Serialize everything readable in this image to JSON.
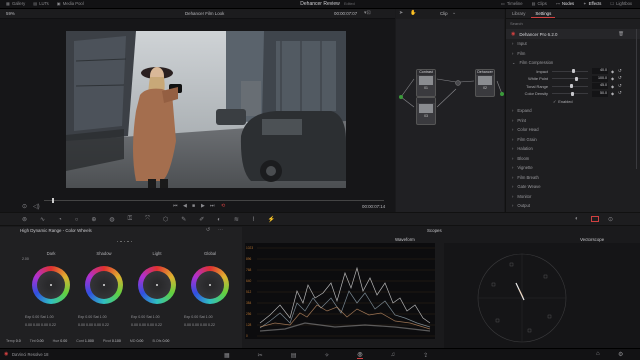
{
  "topbar": {
    "left_items": [
      {
        "icon": "media-pool-icon",
        "label": "Gallery"
      },
      {
        "icon": "luts-icon",
        "label": "LUTs"
      },
      {
        "icon": "media-pool-icon",
        "label": "Media Pool"
      }
    ],
    "title": "Dehancer Review",
    "edited": "Edited",
    "right_items": [
      {
        "icon": "timeline-icon",
        "label": "Timeline"
      },
      {
        "icon": "clips-icon",
        "label": "Clips"
      },
      {
        "icon": "nodes-icon",
        "label": "Nodes"
      },
      {
        "icon": "effects-icon",
        "label": "Effects"
      },
      {
        "icon": "lightbox-icon",
        "label": "Lightbox"
      }
    ]
  },
  "viewer": {
    "zoom": "59%",
    "clip_name": "Dehancer Film Look",
    "timecode_top": "00:00:07:07",
    "timecode_bottom": "00:00:07:14",
    "clip_dropdown": "Clip"
  },
  "nodes": {
    "node1_label": "Contrast",
    "node1_num": "01",
    "node2_num": "03",
    "node3_label": "Dehancer",
    "node3_num": "02"
  },
  "rightpanel": {
    "tabs": [
      "Library",
      "Settings"
    ],
    "search": "Search",
    "plugin_title": "Dehancer Pro 6.2.0",
    "sections_top": [
      "Input",
      "Film"
    ],
    "film_compression": {
      "label": "Film Compression",
      "params": [
        {
          "name": "Impact",
          "value": "40.0",
          "fill": 0.55
        },
        {
          "name": "White Point",
          "value": "100.0",
          "fill": 0.65
        },
        {
          "name": "Tonal Range",
          "value": "45.0",
          "fill": 0.5
        },
        {
          "name": "Color Density",
          "value": "50.0",
          "fill": 0.52
        }
      ],
      "enabled_label": "Enabled"
    },
    "sections_bottom": [
      "Expand",
      "Print",
      "Color Head",
      "Film Grain",
      "Halation",
      "Bloom",
      "Vignette",
      "Film Breath",
      "Gate Weave",
      "Monitor",
      "Output"
    ]
  },
  "colorwheels": {
    "title": "High Dynamic Range - Color Wheels",
    "wheels": [
      {
        "label": "Dark",
        "sub": "2.00"
      },
      {
        "label": "Shadow",
        "sub": ""
      },
      {
        "label": "Light",
        "sub": ""
      },
      {
        "label": "Global",
        "sub": ""
      }
    ],
    "exp_label": "Exp",
    "sat_label": "Sat",
    "row1_val": "0.00",
    "row1_val2": "1.00",
    "rgb_val": "0.00",
    "rgb_val2": "0.22",
    "bottom_labels": [
      "Temp",
      "Tint",
      "Hue",
      "Cont",
      "Pivot",
      "MD",
      "B.Ofs"
    ],
    "bottom_vals": [
      "0.0",
      "0.00",
      "0.00",
      "1.000",
      "0.100",
      "0.00",
      "0.00"
    ]
  },
  "scopes": {
    "title": "Scopes",
    "waveform_label": "Waveform",
    "vectorscope_label": "Vectorscope",
    "ylabels": [
      "1023",
      "896",
      "768",
      "640",
      "512",
      "384",
      "256",
      "128",
      "0"
    ]
  },
  "bottombar": {
    "app": "DaVinci Resolve 18"
  }
}
